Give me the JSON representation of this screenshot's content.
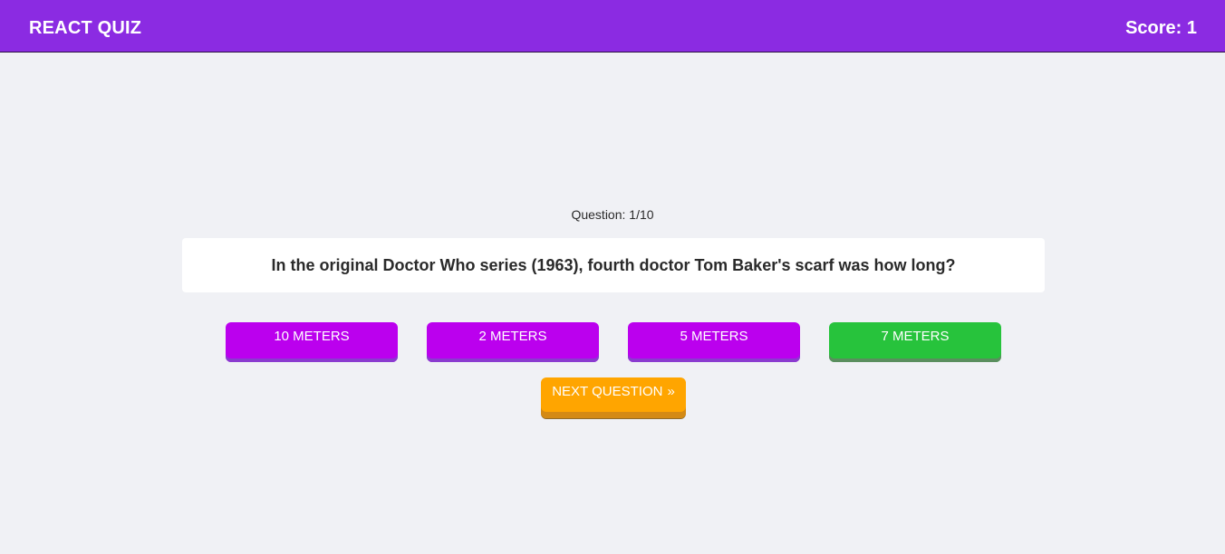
{
  "header": {
    "title": "REACT QUIZ",
    "score": "Score: 1"
  },
  "quiz": {
    "counter": "Question: 1/10",
    "question": "In the original Doctor Who series (1963), fourth doctor Tom Baker's scarf was how long?",
    "answers": [
      {
        "label": "10 METERS",
        "state": "default"
      },
      {
        "label": "2 METERS",
        "state": "default"
      },
      {
        "label": "5 METERS",
        "state": "default"
      },
      {
        "label": "7 METERS",
        "state": "correct"
      }
    ],
    "next_label": "NEXT QUESTION",
    "next_icon": "chevron-double-right-icon"
  },
  "colors": {
    "header": "#8b2be2",
    "answer_default": "#bb00ee",
    "answer_correct": "#27c33c",
    "next_button": "#ffa500",
    "background": "#f0f1f5"
  }
}
